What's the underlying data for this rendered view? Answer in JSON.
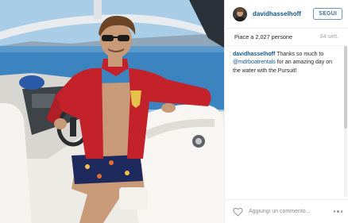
{
  "post": {
    "photo_alt": "",
    "username": "davidhasselhoff",
    "follow_label": "SEGUI",
    "likes_text": "Piace a 2,027 persone",
    "age_text": "84 sett.",
    "caption": {
      "user": "davidhasselhoff",
      "text_before": " Thanks so much to ",
      "mention": "@mdrboatrentals",
      "text_after": " for an amazing day on the water with the Pursuit!"
    },
    "comment_placeholder": "Aggiungi un commento...",
    "icons": {
      "like": "heart-outline-icon",
      "more": "more-options-icon"
    }
  },
  "colors": {
    "link_blue": "#125688",
    "follow_text": "#3f729b",
    "jacket_red": "#c4222b"
  }
}
